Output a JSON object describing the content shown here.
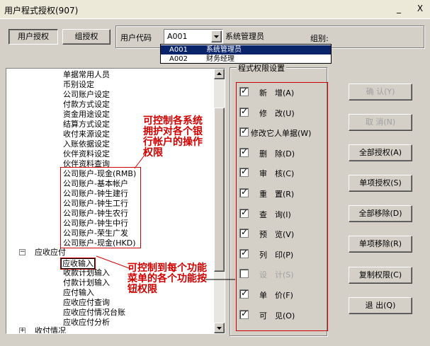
{
  "window": {
    "title": "用户程式授权(907)",
    "minimize": "_",
    "close": "X"
  },
  "tabs": {
    "user_auth": "用户授权",
    "group_auth": "组授权"
  },
  "header": {
    "user_code_label": "用户代码",
    "user_code_value": "A001",
    "user_name": "系统管理员",
    "group_label": "组别:"
  },
  "dropdown": {
    "options": [
      {
        "code": "A001",
        "name": "系统管理员"
      },
      {
        "code": "A002",
        "name": "财务经理"
      }
    ]
  },
  "tree": {
    "items": [
      "单据常用人员",
      "币别设定",
      "公司账户设定",
      "付款方式设定",
      "资金用途设定",
      "结算方式设定",
      "收付来源设定",
      "入账依据设定",
      "伙伴资料设定",
      "伙伴资料查询",
      "公司账户-现金(RMB)",
      "公司账户-基本帐户",
      "公司账户-钟生建行",
      "公司账户-钟生工行",
      "公司账户-钟生农行",
      "公司账户-钟生中行",
      "公司账户-荣生广发",
      "公司账户-现金(HKD)"
    ],
    "ar_group": "应收应付",
    "ar_items": [
      "应收输入",
      "收款计划输入",
      "付款计划输入",
      "应付输入",
      "应收应付查询",
      "应收应付情况台账",
      "应收应付分析"
    ],
    "next_group": "收付情况"
  },
  "annotations": {
    "top": "可控制各系统拥护对各个银行帐户的操作权限",
    "bottom": "可控制到每个功能菜单的各个功能按钮权限"
  },
  "permissions": {
    "title": "程式权限设置",
    "items": [
      {
        "label": "新　增(A)",
        "checked": true,
        "enabled": true
      },
      {
        "label": "修　改(U)",
        "checked": true,
        "enabled": true
      },
      {
        "label": "修改它人单据(W)",
        "checked": true,
        "enabled": true
      },
      {
        "label": "删　除(D)",
        "checked": true,
        "enabled": true
      },
      {
        "label": "审　核(C)",
        "checked": true,
        "enabled": true
      },
      {
        "label": "重　置(R)",
        "checked": true,
        "enabled": true
      },
      {
        "label": "查　询(I)",
        "checked": true,
        "enabled": true
      },
      {
        "label": "预　览(V)",
        "checked": true,
        "enabled": true
      },
      {
        "label": "列　印(P)",
        "checked": true,
        "enabled": true
      },
      {
        "label": "设　计(S)",
        "checked": false,
        "enabled": false
      },
      {
        "label": "单　价(F)",
        "checked": true,
        "enabled": true
      },
      {
        "label": "可　见(O)",
        "checked": true,
        "enabled": true
      }
    ]
  },
  "actions": {
    "confirm": "确 认(Y)",
    "cancel": "取 消(N)",
    "grant_all": "全部授权(A)",
    "grant_single": "单项授权(S)",
    "remove_all": "全部移除(D)",
    "remove_single": "单项移除(R)",
    "copy_perm": "复制权限(C)",
    "exit": "退 出(Q)"
  },
  "colors": {
    "annotation": "#d00000",
    "selection": "#0a246a"
  }
}
